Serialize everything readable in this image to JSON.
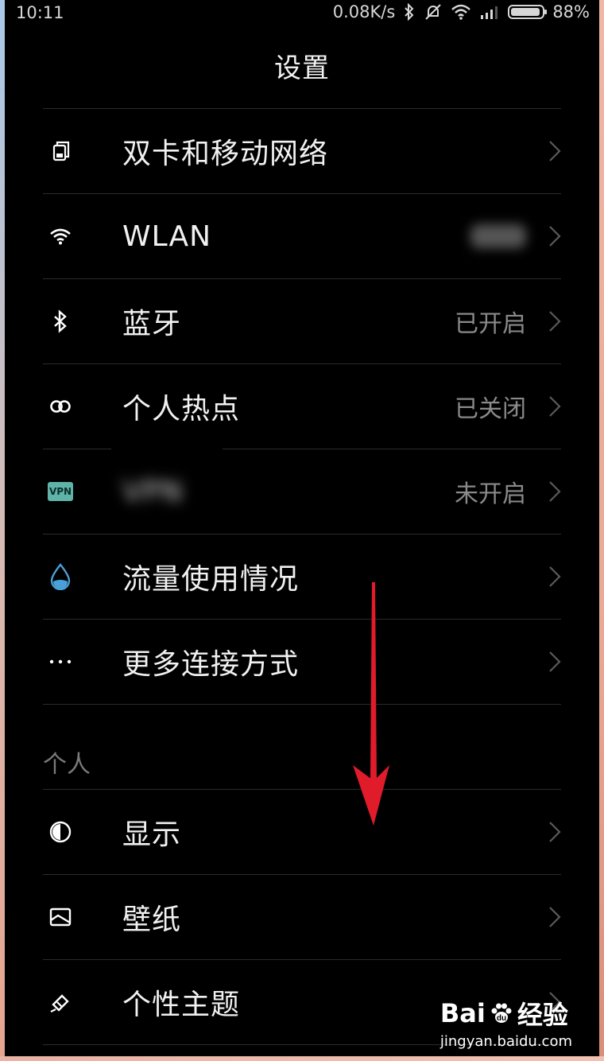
{
  "status_bar": {
    "time": "10:11",
    "net_speed": "0.08K/s",
    "battery": "88%"
  },
  "page": {
    "title": "设置"
  },
  "rows": [
    {
      "icon": "dual-sim-icon",
      "label": "双卡和移动网络",
      "value": ""
    },
    {
      "icon": "wifi-icon",
      "label": "WLAN",
      "value": ""
    },
    {
      "icon": "bluetooth-icon",
      "label": "蓝牙",
      "value": "已开启"
    },
    {
      "icon": "hotspot-icon",
      "label": "个人热点",
      "value": "已关闭"
    },
    {
      "icon": "vpn-icon",
      "label": "VPN",
      "value": "未开启"
    },
    {
      "icon": "data-usage-icon",
      "label": "流量使用情况",
      "value": ""
    },
    {
      "icon": "more-icon",
      "label": "更多连接方式",
      "value": ""
    }
  ],
  "section_personal": {
    "title": "个人"
  },
  "rows_personal": [
    {
      "icon": "display-icon",
      "label": "显示"
    },
    {
      "icon": "wallpaper-icon",
      "label": "壁纸"
    },
    {
      "icon": "theme-icon",
      "label": "个性主题"
    }
  ],
  "vpn_badge": "VPN",
  "watermark": {
    "brand": "Bai",
    "brand2": "经验",
    "url": "jingyan.baidu.com"
  },
  "colors": {
    "arrow": "#e01b2a",
    "accent_drop": "#4aa0d8",
    "vpn_badge": "#5fb3a8"
  }
}
